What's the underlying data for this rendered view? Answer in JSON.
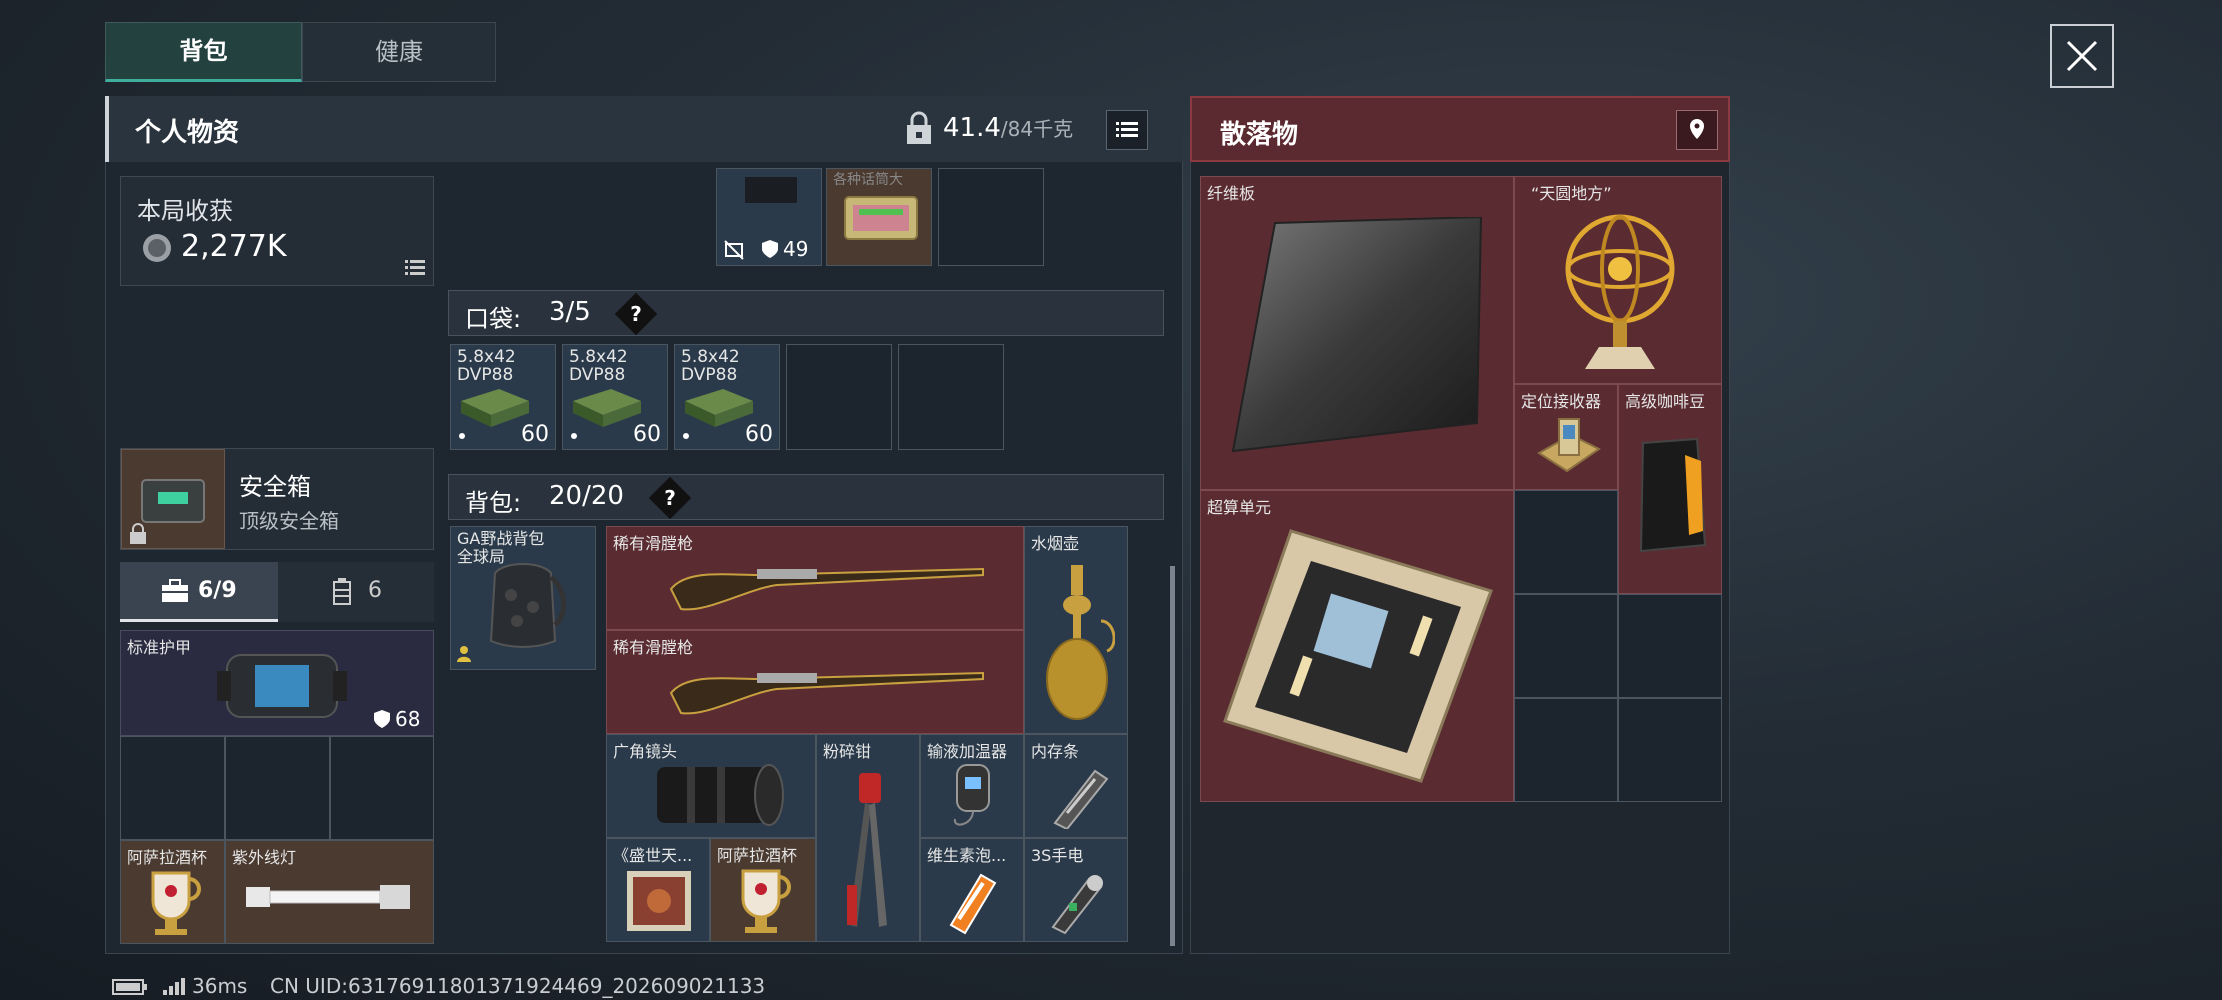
{
  "tabs": {
    "backpack": "背包",
    "health": "健康"
  },
  "personal": {
    "title": "个人物资",
    "weight_current": "41.4",
    "weight_max": "/84千克"
  },
  "loot": {
    "title": "散落物"
  },
  "summary": {
    "title": "本局收获",
    "value": "2,277K"
  },
  "safebox": {
    "title": "安全箱",
    "subtitle": "顶级安全箱"
  },
  "equip_tabs": {
    "gear_count": "6/9",
    "ammo_count": "6"
  },
  "armor": {
    "label": "标准护甲",
    "durability": "68"
  },
  "vest_items": {
    "cup": "阿萨拉酒杯",
    "uv_lamp": "紫外线灯"
  },
  "top_row": {
    "durability": "49",
    "box_label": "各种话筒大"
  },
  "pocket": {
    "label": "口袋:",
    "count": "3/5",
    "help": "?",
    "ammo_label": "5.8x42\nDVP88",
    "ammo_qty": "60"
  },
  "backpack": {
    "label": "背包:",
    "count": "20/20",
    "help": "?",
    "bag_name": "GA野战背包\n全球局"
  },
  "bp_items": {
    "musket1": "稀有滑膛枪",
    "musket2": "稀有滑膛枪",
    "hookah": "水烟壶",
    "lens": "广角镜头",
    "crusher": "粉碎钳",
    "infuser": "输液加温器",
    "ram": "内存条",
    "book": "《盛世天...",
    "cup": "阿萨拉酒杯",
    "vitamin": "维生素泡...",
    "phone": "3S手电"
  },
  "loot_items": {
    "fiber": "纤维板",
    "sphere": "“天圆地方”",
    "locator": "定位接收器",
    "coffee": "高级咖啡豆",
    "compute": "超算单元"
  },
  "status": {
    "ping": "36ms",
    "uid": "CN UID:6317691180137192446​9_202609021133"
  },
  "colors": {
    "accent": "#3fae9c",
    "loot_red": "#6a2a30"
  }
}
